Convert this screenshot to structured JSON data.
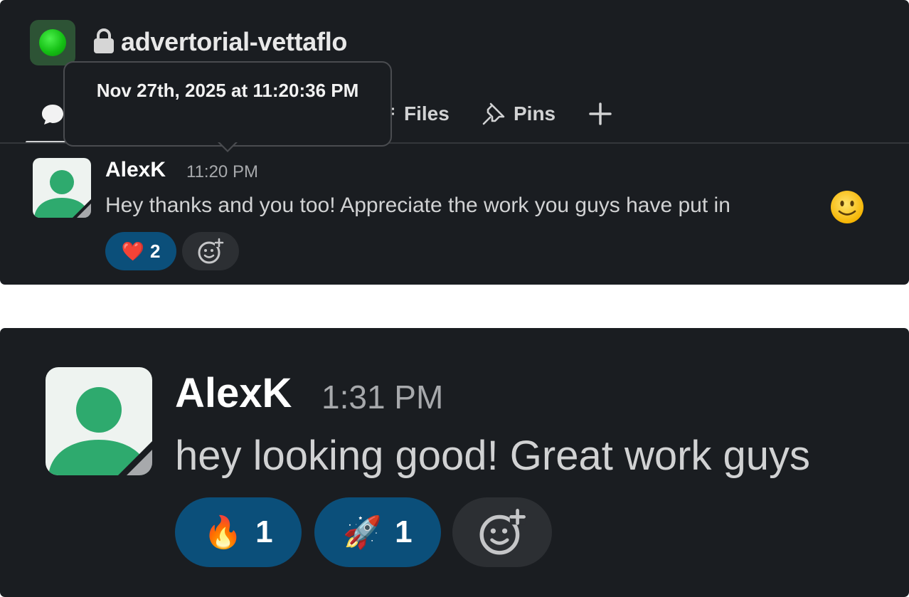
{
  "channel": {
    "name": "advertorial-vettaflo",
    "status_color": "#1ec41e",
    "private_icon": "lock-icon"
  },
  "tabs": [
    {
      "label": "Files",
      "icon": "files-icon"
    },
    {
      "label": "Pins",
      "icon": "pin-icon"
    }
  ],
  "tooltip": {
    "text": "Nov 27th, 2025 at 11:20:36 PM"
  },
  "messages": [
    {
      "author": "AlexK",
      "time": "11:20 PM",
      "text": "Hey thanks and you too! Appreciate the work you guys have put in",
      "emoji": "slightly-smiling-face",
      "reactions": [
        {
          "emoji": "❤️",
          "count": "2"
        }
      ]
    },
    {
      "author": "AlexK",
      "time": "1:31 PM",
      "text": "hey looking good! Great work guys",
      "reactions": [
        {
          "emoji": "🔥",
          "count": "1"
        },
        {
          "emoji": "🚀",
          "count": "1"
        }
      ]
    }
  ],
  "colors": {
    "background": "#1a1d21",
    "reaction_active": "#0b4f7a",
    "reaction_add": "#2c2f33",
    "avatar_green": "#2eaa6e"
  }
}
